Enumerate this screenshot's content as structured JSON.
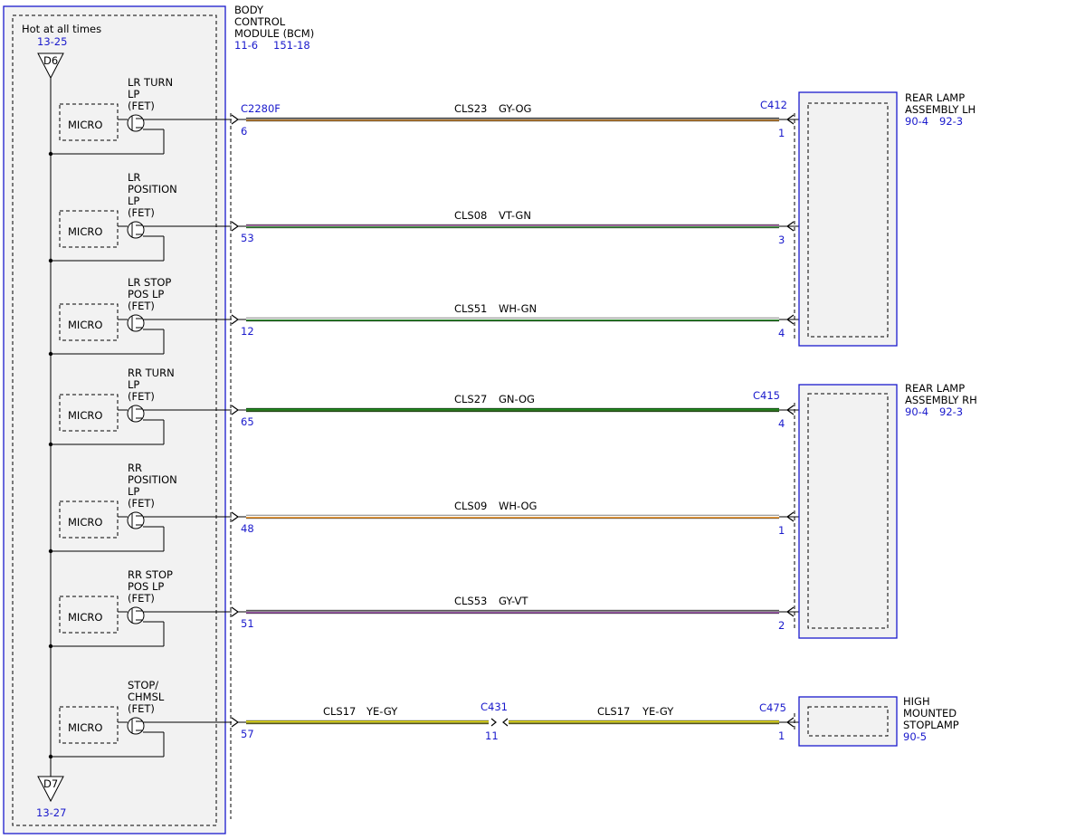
{
  "bcm": {
    "name": [
      "BODY",
      "CONTROL",
      "MODULE (BCM)"
    ],
    "refs": [
      "11-6",
      "151-18"
    ],
    "hot_label": "Hot at all times",
    "top_ref": "13-25",
    "top_node": "D6",
    "bottom_node": "D7",
    "bottom_ref": "13-27",
    "connector": "C2280F"
  },
  "micro_label": "MICRO",
  "drivers": [
    {
      "label": [
        "LR TURN",
        "LP",
        "(FET)"
      ],
      "pin": "6",
      "circuit": "CLS23",
      "color": "GY-OG",
      "far_pin": "1",
      "far_connector": "C412",
      "colors": [
        "#808080",
        "#c88a3a"
      ]
    },
    {
      "label": [
        "LR",
        "POSITION",
        "LP",
        "(FET)"
      ],
      "pin": "53",
      "circuit": "CLS08",
      "color": "VT-GN",
      "far_pin": "3",
      "far_connector": "",
      "colors": [
        "#b070b0",
        "#4a9a4a"
      ]
    },
    {
      "label": [
        "LR STOP",
        "POS LP",
        "(FET)"
      ],
      "pin": "12",
      "circuit": "CLS51",
      "color": "WH-GN",
      "far_pin": "4",
      "far_connector": "",
      "colors": [
        "#ffffff",
        "#2e8b2e"
      ]
    },
    {
      "label": [
        "RR TURN",
        "LP",
        "(FET)"
      ],
      "pin": "65",
      "circuit": "CLS27",
      "color": "GN-OG",
      "far_pin": "4",
      "far_connector": "C415",
      "colors": [
        "#1f8a1f",
        "#2f6f1f"
      ]
    },
    {
      "label": [
        "RR",
        "POSITION",
        "LP",
        "(FET)"
      ],
      "pin": "48",
      "circuit": "CLS09",
      "color": "WH-OG",
      "far_pin": "1",
      "far_connector": "",
      "colors": [
        "#ffffff",
        "#f0a040"
      ]
    },
    {
      "label": [
        "RR STOP",
        "POS LP",
        "(FET)"
      ],
      "pin": "51",
      "circuit": "CLS53",
      "color": "GY-VT",
      "far_pin": "2",
      "far_connector": "",
      "colors": [
        "#8a8a8a",
        "#9a5aa8"
      ]
    },
    {
      "label": [
        "STOP/",
        "CHMSL",
        "(FET)"
      ],
      "pin": "57",
      "circuit": "CLS17",
      "color": "YE-GY",
      "far_pin": "1",
      "far_connector": "C475",
      "colors": [
        "#e8e020",
        "#8a8a30"
      ],
      "inline_connector": "C431",
      "inline_pin": "11",
      "circuit2": "CLS17",
      "color2": "YE-GY"
    }
  ],
  "components": [
    {
      "name": [
        "REAR LAMP",
        "ASSEMBLY LH"
      ],
      "refs": [
        "90-4",
        "92-3"
      ]
    },
    {
      "name": [
        "REAR LAMP",
        "ASSEMBLY RH"
      ],
      "refs": [
        "90-4",
        "92-3"
      ]
    },
    {
      "name": [
        "HIGH",
        "MOUNTED",
        "STOPLAMP"
      ],
      "refs": [
        "90-5"
      ]
    }
  ]
}
